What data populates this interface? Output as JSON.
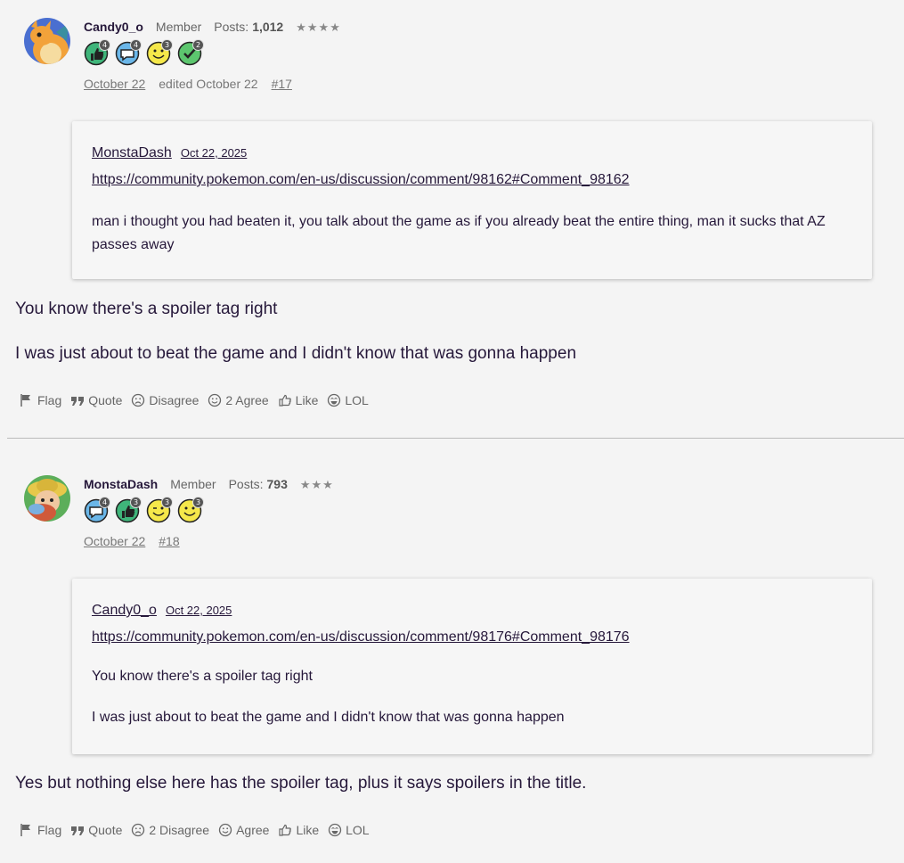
{
  "comments": [
    {
      "author": "Candy0_o",
      "role": "Member",
      "posts_label": "Posts:",
      "posts": "1,012",
      "rank": "★★★★",
      "badges": [
        {
          "name": "like-badge-icon",
          "count": "4"
        },
        {
          "name": "comment-badge-icon",
          "count": "4"
        },
        {
          "name": "lol-badge-icon",
          "count": "3"
        },
        {
          "name": "agree-badge-icon",
          "count": "2"
        }
      ],
      "date": "October 22",
      "edited": "edited October 22",
      "permalink": "#17",
      "quote": {
        "author": "MonstaDash",
        "date": "Oct 22, 2025",
        "link": "https://community.pokemon.com/en-us/discussion/comment/98162#Comment_98162",
        "paragraphs": [
          "man i thought you had beaten it, you talk about the game as if you already beat the entire thing, man it sucks that AZ passes away"
        ]
      },
      "body": [
        "You know there's a spoiler tag right",
        "I was just about to beat the game and I didn't know that was gonna happen"
      ],
      "actions": {
        "flag": "Flag",
        "quote": "Quote",
        "disagree": "Disagree",
        "agree": "2 Agree",
        "like": "Like",
        "lol": "LOL"
      }
    },
    {
      "author": "MonstaDash",
      "role": "Member",
      "posts_label": "Posts:",
      "posts": "793",
      "rank": "★★★",
      "badges": [
        {
          "name": "comment-badge-icon",
          "count": "4"
        },
        {
          "name": "like-badge-icon",
          "count": "3"
        },
        {
          "name": "wink-badge-icon",
          "count": "3"
        },
        {
          "name": "lol-badge-icon",
          "count": "3"
        }
      ],
      "date": "October 22",
      "permalink": "#18",
      "quote": {
        "author": "Candy0_o",
        "date": "Oct 22, 2025",
        "link": "https://community.pokemon.com/en-us/discussion/comment/98176#Comment_98176",
        "paragraphs": [
          "You know there's a spoiler tag right",
          "I was just about to beat the game and I didn't know that was gonna happen"
        ]
      },
      "body": [
        "Yes but nothing else here has the spoiler tag, plus it says spoilers in the title."
      ],
      "actions": {
        "flag": "Flag",
        "quote": "Quote",
        "disagree": "2 Disagree",
        "agree": "Agree",
        "like": "Like",
        "lol": "LOL"
      }
    }
  ],
  "colors": {
    "background": "#f4f4f4",
    "text": "#26183a",
    "muted": "#666666"
  }
}
